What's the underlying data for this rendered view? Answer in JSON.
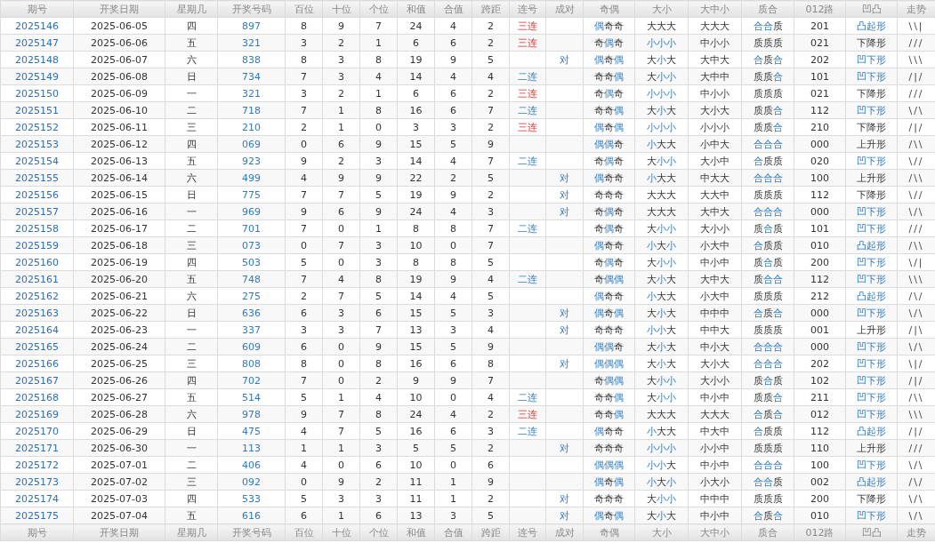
{
  "table": {
    "columns": [
      "期号",
      "开奖日期",
      "星期几",
      "开奖号码",
      "百位",
      "十位",
      "个位",
      "和值",
      "合值",
      "跨距",
      "连号",
      "成对",
      "奇偶",
      "大小",
      "大中小",
      "质合",
      "012路",
      "凹凸",
      "走势"
    ],
    "footer_columns": [
      "期号",
      "开奖日期",
      "星期几",
      "开奖号码",
      "百位",
      "十位",
      "个位",
      "和值",
      "合值",
      "跨距",
      "连号",
      "成对",
      "奇偶",
      "大小",
      "大中小",
      "质合",
      "012路",
      "凹凸",
      "走势"
    ],
    "rows": [
      {
        "period": "2025146",
        "date": "2025-06-05",
        "weekday": "四",
        "number": "897",
        "hundreds": "8",
        "tens": "9",
        "units": "7",
        "sum": "24",
        "sum_tail": "4",
        "span": "2",
        "consecutive": {
          "text": "三连",
          "kind": "triple"
        },
        "parity": {
          "text": "偶奇奇",
          "marks": [
            true,
            false,
            false
          ]
        },
        "size": {
          "text": "大大大",
          "marks": [
            false,
            false,
            false
          ]
        },
        "size3": "大大大",
        "prime": {
          "text": "合合质",
          "marks": [
            true,
            true,
            false
          ]
        },
        "route": "201",
        "shape": {
          "text": "凸起形",
          "highlight": true
        },
        "trend": "\\\\|"
      },
      {
        "period": "2025147",
        "date": "2025-06-06",
        "weekday": "五",
        "number": "321",
        "hundreds": "3",
        "tens": "2",
        "units": "1",
        "sum": "6",
        "sum_tail": "6",
        "span": "2",
        "consecutive": {
          "text": "三连",
          "kind": "triple"
        },
        "parity": {
          "text": "奇偶奇",
          "marks": [
            false,
            true,
            false
          ]
        },
        "size": {
          "text": "小小小",
          "marks": [
            true,
            true,
            true
          ]
        },
        "size3": "中小小",
        "prime": {
          "text": "质质质",
          "marks": [
            false,
            false,
            false
          ]
        },
        "route": "021",
        "shape": {
          "text": "下降形",
          "highlight": false
        },
        "trend": "///"
      },
      {
        "period": "2025148",
        "date": "2025-06-07",
        "weekday": "六",
        "number": "838",
        "hundreds": "8",
        "tens": "3",
        "units": "8",
        "sum": "19",
        "sum_tail": "9",
        "span": "5",
        "pair": "对",
        "parity": {
          "text": "偶奇偶",
          "marks": [
            true,
            false,
            true
          ]
        },
        "size": {
          "text": "大小大",
          "marks": [
            false,
            true,
            false
          ]
        },
        "size3": "大中大",
        "prime": {
          "text": "合质合",
          "marks": [
            true,
            false,
            true
          ]
        },
        "route": "202",
        "shape": {
          "text": "凹下形",
          "highlight": true
        },
        "trend": "\\\\\\"
      },
      {
        "period": "2025149",
        "date": "2025-06-08",
        "weekday": "日",
        "number": "734",
        "hundreds": "7",
        "tens": "3",
        "units": "4",
        "sum": "14",
        "sum_tail": "4",
        "span": "4",
        "consecutive": {
          "text": "二连",
          "kind": "double"
        },
        "parity": {
          "text": "奇奇偶",
          "marks": [
            false,
            false,
            true
          ]
        },
        "size": {
          "text": "大小小",
          "marks": [
            false,
            true,
            true
          ]
        },
        "size3": "大中中",
        "prime": {
          "text": "质质合",
          "marks": [
            false,
            false,
            true
          ]
        },
        "route": "101",
        "shape": {
          "text": "凹下形",
          "highlight": true
        },
        "trend": "/|/"
      },
      {
        "period": "2025150",
        "date": "2025-06-09",
        "weekday": "一",
        "number": "321",
        "hundreds": "3",
        "tens": "2",
        "units": "1",
        "sum": "6",
        "sum_tail": "6",
        "span": "2",
        "consecutive": {
          "text": "三连",
          "kind": "triple"
        },
        "parity": {
          "text": "奇偶奇",
          "marks": [
            false,
            true,
            false
          ]
        },
        "size": {
          "text": "小小小",
          "marks": [
            true,
            true,
            true
          ]
        },
        "size3": "中小小",
        "prime": {
          "text": "质质质",
          "marks": [
            false,
            false,
            false
          ]
        },
        "route": "021",
        "shape": {
          "text": "下降形",
          "highlight": false
        },
        "trend": "///"
      },
      {
        "period": "2025151",
        "date": "2025-06-10",
        "weekday": "二",
        "number": "718",
        "hundreds": "7",
        "tens": "1",
        "units": "8",
        "sum": "16",
        "sum_tail": "6",
        "span": "7",
        "consecutive": {
          "text": "二连",
          "kind": "double"
        },
        "parity": {
          "text": "奇奇偶",
          "marks": [
            false,
            false,
            true
          ]
        },
        "size": {
          "text": "大小大",
          "marks": [
            false,
            true,
            false
          ]
        },
        "size3": "大小大",
        "prime": {
          "text": "质质合",
          "marks": [
            false,
            false,
            true
          ]
        },
        "route": "112",
        "shape": {
          "text": "凹下形",
          "highlight": true
        },
        "trend": "\\/\\"
      },
      {
        "period": "2025152",
        "date": "2025-06-11",
        "weekday": "三",
        "number": "210",
        "hundreds": "2",
        "tens": "1",
        "units": "0",
        "sum": "3",
        "sum_tail": "3",
        "span": "2",
        "consecutive": {
          "text": "三连",
          "kind": "triple"
        },
        "parity": {
          "text": "偶奇偶",
          "marks": [
            true,
            false,
            true
          ]
        },
        "size": {
          "text": "小小小",
          "marks": [
            true,
            true,
            true
          ]
        },
        "size3": "小小小",
        "prime": {
          "text": "质质合",
          "marks": [
            false,
            false,
            true
          ]
        },
        "route": "210",
        "shape": {
          "text": "下降形",
          "highlight": false
        },
        "trend": "/|/"
      },
      {
        "period": "2025153",
        "date": "2025-06-12",
        "weekday": "四",
        "number": "069",
        "hundreds": "0",
        "tens": "6",
        "units": "9",
        "sum": "15",
        "sum_tail": "5",
        "span": "9",
        "parity": {
          "text": "偶偶奇",
          "marks": [
            true,
            true,
            false
          ]
        },
        "size": {
          "text": "小大大",
          "marks": [
            true,
            false,
            false
          ]
        },
        "size3": "小中大",
        "prime": {
          "text": "合合合",
          "marks": [
            true,
            true,
            true
          ]
        },
        "route": "000",
        "shape": {
          "text": "上升形",
          "highlight": false
        },
        "trend": "/\\\\"
      },
      {
        "period": "2025154",
        "date": "2025-06-13",
        "weekday": "五",
        "number": "923",
        "hundreds": "9",
        "tens": "2",
        "units": "3",
        "sum": "14",
        "sum_tail": "4",
        "span": "7",
        "consecutive": {
          "text": "二连",
          "kind": "double"
        },
        "parity": {
          "text": "奇偶奇",
          "marks": [
            false,
            true,
            false
          ]
        },
        "size": {
          "text": "大小小",
          "marks": [
            false,
            true,
            true
          ]
        },
        "size3": "大小中",
        "prime": {
          "text": "合质质",
          "marks": [
            true,
            false,
            false
          ]
        },
        "route": "020",
        "shape": {
          "text": "凹下形",
          "highlight": true
        },
        "trend": "\\//"
      },
      {
        "period": "2025155",
        "date": "2025-06-14",
        "weekday": "六",
        "number": "499",
        "hundreds": "4",
        "tens": "9",
        "units": "9",
        "sum": "22",
        "sum_tail": "2",
        "span": "5",
        "pair": "对",
        "parity": {
          "text": "偶奇奇",
          "marks": [
            true,
            false,
            false
          ]
        },
        "size": {
          "text": "小大大",
          "marks": [
            true,
            false,
            false
          ]
        },
        "size3": "中大大",
        "prime": {
          "text": "合合合",
          "marks": [
            true,
            true,
            true
          ]
        },
        "route": "100",
        "shape": {
          "text": "上升形",
          "highlight": false
        },
        "trend": "/\\\\"
      },
      {
        "period": "2025156",
        "date": "2025-06-15",
        "weekday": "日",
        "number": "775",
        "hundreds": "7",
        "tens": "7",
        "units": "5",
        "sum": "19",
        "sum_tail": "9",
        "span": "2",
        "pair": "对",
        "parity": {
          "text": "奇奇奇",
          "marks": [
            false,
            false,
            false
          ]
        },
        "size": {
          "text": "大大大",
          "marks": [
            false,
            false,
            false
          ]
        },
        "size3": "大大中",
        "prime": {
          "text": "质质质",
          "marks": [
            false,
            false,
            false
          ]
        },
        "route": "112",
        "shape": {
          "text": "下降形",
          "highlight": false
        },
        "trend": "\\//"
      },
      {
        "period": "2025157",
        "date": "2025-06-16",
        "weekday": "一",
        "number": "969",
        "hundreds": "9",
        "tens": "6",
        "units": "9",
        "sum": "24",
        "sum_tail": "4",
        "span": "3",
        "pair": "对",
        "parity": {
          "text": "奇偶奇",
          "marks": [
            false,
            true,
            false
          ]
        },
        "size": {
          "text": "大大大",
          "marks": [
            false,
            false,
            false
          ]
        },
        "size3": "大中大",
        "prime": {
          "text": "合合合",
          "marks": [
            true,
            true,
            true
          ]
        },
        "route": "000",
        "shape": {
          "text": "凹下形",
          "highlight": true
        },
        "trend": "\\/\\"
      },
      {
        "period": "2025158",
        "date": "2025-06-17",
        "weekday": "二",
        "number": "701",
        "hundreds": "7",
        "tens": "0",
        "units": "1",
        "sum": "8",
        "sum_tail": "8",
        "span": "7",
        "consecutive": {
          "text": "二连",
          "kind": "double"
        },
        "parity": {
          "text": "奇偶奇",
          "marks": [
            false,
            true,
            false
          ]
        },
        "size": {
          "text": "大小小",
          "marks": [
            false,
            true,
            true
          ]
        },
        "size3": "大小小",
        "prime": {
          "text": "质合质",
          "marks": [
            false,
            true,
            false
          ]
        },
        "route": "101",
        "shape": {
          "text": "凹下形",
          "highlight": true
        },
        "trend": "///"
      },
      {
        "period": "2025159",
        "date": "2025-06-18",
        "weekday": "三",
        "number": "073",
        "hundreds": "0",
        "tens": "7",
        "units": "3",
        "sum": "10",
        "sum_tail": "0",
        "span": "7",
        "parity": {
          "text": "偶奇奇",
          "marks": [
            true,
            false,
            false
          ]
        },
        "size": {
          "text": "小大小",
          "marks": [
            true,
            false,
            true
          ]
        },
        "size3": "小大中",
        "prime": {
          "text": "合质质",
          "marks": [
            true,
            false,
            false
          ]
        },
        "route": "010",
        "shape": {
          "text": "凸起形",
          "highlight": true
        },
        "trend": "/\\\\"
      },
      {
        "period": "2025160",
        "date": "2025-06-19",
        "weekday": "四",
        "number": "503",
        "hundreds": "5",
        "tens": "0",
        "units": "3",
        "sum": "8",
        "sum_tail": "8",
        "span": "5",
        "parity": {
          "text": "奇偶奇",
          "marks": [
            false,
            true,
            false
          ]
        },
        "size": {
          "text": "大小小",
          "marks": [
            false,
            true,
            true
          ]
        },
        "size3": "中小中",
        "prime": {
          "text": "质合质",
          "marks": [
            false,
            true,
            false
          ]
        },
        "route": "200",
        "shape": {
          "text": "凹下形",
          "highlight": true
        },
        "trend": "\\/|"
      },
      {
        "period": "2025161",
        "date": "2025-06-20",
        "weekday": "五",
        "number": "748",
        "hundreds": "7",
        "tens": "4",
        "units": "8",
        "sum": "19",
        "sum_tail": "9",
        "span": "4",
        "consecutive": {
          "text": "二连",
          "kind": "double"
        },
        "parity": {
          "text": "奇偶偶",
          "marks": [
            false,
            true,
            true
          ]
        },
        "size": {
          "text": "大小大",
          "marks": [
            false,
            true,
            false
          ]
        },
        "size3": "大中大",
        "prime": {
          "text": "质合合",
          "marks": [
            false,
            true,
            true
          ]
        },
        "route": "112",
        "shape": {
          "text": "凹下形",
          "highlight": true
        },
        "trend": "\\\\\\"
      },
      {
        "period": "2025162",
        "date": "2025-06-21",
        "weekday": "六",
        "number": "275",
        "hundreds": "2",
        "tens": "7",
        "units": "5",
        "sum": "14",
        "sum_tail": "4",
        "span": "5",
        "parity": {
          "text": "偶奇奇",
          "marks": [
            true,
            false,
            false
          ]
        },
        "size": {
          "text": "小大大",
          "marks": [
            true,
            false,
            false
          ]
        },
        "size3": "小大中",
        "prime": {
          "text": "质质质",
          "marks": [
            false,
            false,
            false
          ]
        },
        "route": "212",
        "shape": {
          "text": "凸起形",
          "highlight": true
        },
        "trend": "/\\/"
      },
      {
        "period": "2025163",
        "date": "2025-06-22",
        "weekday": "日",
        "number": "636",
        "hundreds": "6",
        "tens": "3",
        "units": "6",
        "sum": "15",
        "sum_tail": "5",
        "span": "3",
        "pair": "对",
        "parity": {
          "text": "偶奇偶",
          "marks": [
            true,
            false,
            true
          ]
        },
        "size": {
          "text": "大小大",
          "marks": [
            false,
            true,
            false
          ]
        },
        "size3": "中中中",
        "prime": {
          "text": "合质合",
          "marks": [
            true,
            false,
            true
          ]
        },
        "route": "000",
        "shape": {
          "text": "凹下形",
          "highlight": true
        },
        "trend": "\\/\\"
      },
      {
        "period": "2025164",
        "date": "2025-06-23",
        "weekday": "一",
        "number": "337",
        "hundreds": "3",
        "tens": "3",
        "units": "7",
        "sum": "13",
        "sum_tail": "3",
        "span": "4",
        "pair": "对",
        "parity": {
          "text": "奇奇奇",
          "marks": [
            false,
            false,
            false
          ]
        },
        "size": {
          "text": "小小大",
          "marks": [
            true,
            true,
            false
          ]
        },
        "size3": "中中大",
        "prime": {
          "text": "质质质",
          "marks": [
            false,
            false,
            false
          ]
        },
        "route": "001",
        "shape": {
          "text": "上升形",
          "highlight": false
        },
        "trend": "/|\\"
      },
      {
        "period": "2025165",
        "date": "2025-06-24",
        "weekday": "二",
        "number": "609",
        "hundreds": "6",
        "tens": "0",
        "units": "9",
        "sum": "15",
        "sum_tail": "5",
        "span": "9",
        "parity": {
          "text": "偶偶奇",
          "marks": [
            true,
            true,
            false
          ]
        },
        "size": {
          "text": "大小大",
          "marks": [
            false,
            true,
            false
          ]
        },
        "size3": "中小大",
        "prime": {
          "text": "合合合",
          "marks": [
            true,
            true,
            true
          ]
        },
        "route": "000",
        "shape": {
          "text": "凹下形",
          "highlight": true
        },
        "trend": "\\/\\"
      },
      {
        "period": "2025166",
        "date": "2025-06-25",
        "weekday": "三",
        "number": "808",
        "hundreds": "8",
        "tens": "0",
        "units": "8",
        "sum": "16",
        "sum_tail": "6",
        "span": "8",
        "pair": "对",
        "parity": {
          "text": "偶偶偶",
          "marks": [
            true,
            true,
            true
          ]
        },
        "size": {
          "text": "大小大",
          "marks": [
            false,
            true,
            false
          ]
        },
        "size3": "大小大",
        "prime": {
          "text": "合合合",
          "marks": [
            true,
            true,
            true
          ]
        },
        "route": "202",
        "shape": {
          "text": "凹下形",
          "highlight": true
        },
        "trend": "\\|/"
      },
      {
        "period": "2025167",
        "date": "2025-06-26",
        "weekday": "四",
        "number": "702",
        "hundreds": "7",
        "tens": "0",
        "units": "2",
        "sum": "9",
        "sum_tail": "9",
        "span": "7",
        "parity": {
          "text": "奇偶偶",
          "marks": [
            false,
            true,
            true
          ]
        },
        "size": {
          "text": "大小小",
          "marks": [
            false,
            true,
            true
          ]
        },
        "size3": "大小小",
        "prime": {
          "text": "质合质",
          "marks": [
            false,
            true,
            false
          ]
        },
        "route": "102",
        "shape": {
          "text": "凹下形",
          "highlight": true
        },
        "trend": "/|/"
      },
      {
        "period": "2025168",
        "date": "2025-06-27",
        "weekday": "五",
        "number": "514",
        "hundreds": "5",
        "tens": "1",
        "units": "4",
        "sum": "10",
        "sum_tail": "0",
        "span": "4",
        "consecutive": {
          "text": "二连",
          "kind": "double"
        },
        "parity": {
          "text": "奇奇偶",
          "marks": [
            false,
            false,
            true
          ]
        },
        "size": {
          "text": "大小小",
          "marks": [
            false,
            true,
            true
          ]
        },
        "size3": "中小中",
        "prime": {
          "text": "质质合",
          "marks": [
            false,
            false,
            true
          ]
        },
        "route": "211",
        "shape": {
          "text": "凹下形",
          "highlight": true
        },
        "trend": "/\\\\"
      },
      {
        "period": "2025169",
        "date": "2025-06-28",
        "weekday": "六",
        "number": "978",
        "hundreds": "9",
        "tens": "7",
        "units": "8",
        "sum": "24",
        "sum_tail": "4",
        "span": "2",
        "consecutive": {
          "text": "三连",
          "kind": "triple"
        },
        "parity": {
          "text": "奇奇偶",
          "marks": [
            false,
            false,
            true
          ]
        },
        "size": {
          "text": "大大大",
          "marks": [
            false,
            false,
            false
          ]
        },
        "size3": "大大大",
        "prime": {
          "text": "合质合",
          "marks": [
            true,
            false,
            true
          ]
        },
        "route": "012",
        "shape": {
          "text": "凹下形",
          "highlight": true
        },
        "trend": "\\\\\\"
      },
      {
        "period": "2025170",
        "date": "2025-06-29",
        "weekday": "日",
        "number": "475",
        "hundreds": "4",
        "tens": "7",
        "units": "5",
        "sum": "16",
        "sum_tail": "6",
        "span": "3",
        "consecutive": {
          "text": "二连",
          "kind": "double"
        },
        "parity": {
          "text": "偶奇奇",
          "marks": [
            true,
            false,
            false
          ]
        },
        "size": {
          "text": "小大大",
          "marks": [
            true,
            false,
            false
          ]
        },
        "size3": "中大中",
        "prime": {
          "text": "合质质",
          "marks": [
            true,
            false,
            false
          ]
        },
        "route": "112",
        "shape": {
          "text": "凸起形",
          "highlight": true
        },
        "trend": "/|/"
      },
      {
        "period": "2025171",
        "date": "2025-06-30",
        "weekday": "一",
        "number": "113",
        "hundreds": "1",
        "tens": "1",
        "units": "3",
        "sum": "5",
        "sum_tail": "5",
        "span": "2",
        "pair": "对",
        "parity": {
          "text": "奇奇奇",
          "marks": [
            false,
            false,
            false
          ]
        },
        "size": {
          "text": "小小小",
          "marks": [
            true,
            true,
            true
          ]
        },
        "size3": "小小中",
        "prime": {
          "text": "质质质",
          "marks": [
            false,
            false,
            false
          ]
        },
        "route": "110",
        "shape": {
          "text": "上升形",
          "highlight": false
        },
        "trend": "///"
      },
      {
        "period": "2025172",
        "date": "2025-07-01",
        "weekday": "二",
        "number": "406",
        "hundreds": "4",
        "tens": "0",
        "units": "6",
        "sum": "10",
        "sum_tail": "0",
        "span": "6",
        "parity": {
          "text": "偶偶偶",
          "marks": [
            true,
            true,
            true
          ]
        },
        "size": {
          "text": "小小大",
          "marks": [
            true,
            true,
            false
          ]
        },
        "size3": "中小中",
        "prime": {
          "text": "合合合",
          "marks": [
            true,
            true,
            true
          ]
        },
        "route": "100",
        "shape": {
          "text": "凹下形",
          "highlight": true
        },
        "trend": "\\/\\"
      },
      {
        "period": "2025173",
        "date": "2025-07-02",
        "weekday": "三",
        "number": "092",
        "hundreds": "0",
        "tens": "9",
        "units": "2",
        "sum": "11",
        "sum_tail": "1",
        "span": "9",
        "parity": {
          "text": "偶奇偶",
          "marks": [
            true,
            false,
            true
          ]
        },
        "size": {
          "text": "小大小",
          "marks": [
            true,
            false,
            true
          ]
        },
        "size3": "小大小",
        "prime": {
          "text": "合合质",
          "marks": [
            true,
            true,
            false
          ]
        },
        "route": "002",
        "shape": {
          "text": "凸起形",
          "highlight": true
        },
        "trend": "/\\/"
      },
      {
        "period": "2025174",
        "date": "2025-07-03",
        "weekday": "四",
        "number": "533",
        "hundreds": "5",
        "tens": "3",
        "units": "3",
        "sum": "11",
        "sum_tail": "1",
        "span": "2",
        "pair": "对",
        "parity": {
          "text": "奇奇奇",
          "marks": [
            false,
            false,
            false
          ]
        },
        "size": {
          "text": "大小小",
          "marks": [
            false,
            true,
            true
          ]
        },
        "size3": "中中中",
        "prime": {
          "text": "质质质",
          "marks": [
            false,
            false,
            false
          ]
        },
        "route": "200",
        "shape": {
          "text": "下降形",
          "highlight": false
        },
        "trend": "\\/\\"
      },
      {
        "period": "2025175",
        "date": "2025-07-04",
        "weekday": "五",
        "number": "616",
        "hundreds": "6",
        "tens": "1",
        "units": "6",
        "sum": "13",
        "sum_tail": "3",
        "span": "5",
        "pair": "对",
        "parity": {
          "text": "偶奇偶",
          "marks": [
            true,
            false,
            true
          ]
        },
        "size": {
          "text": "大小大",
          "marks": [
            false,
            true,
            false
          ]
        },
        "size3": "中小中",
        "prime": {
          "text": "合质合",
          "marks": [
            true,
            false,
            true
          ]
        },
        "route": "010",
        "shape": {
          "text": "凹下形",
          "highlight": true
        },
        "trend": "\\/\\"
      }
    ]
  }
}
